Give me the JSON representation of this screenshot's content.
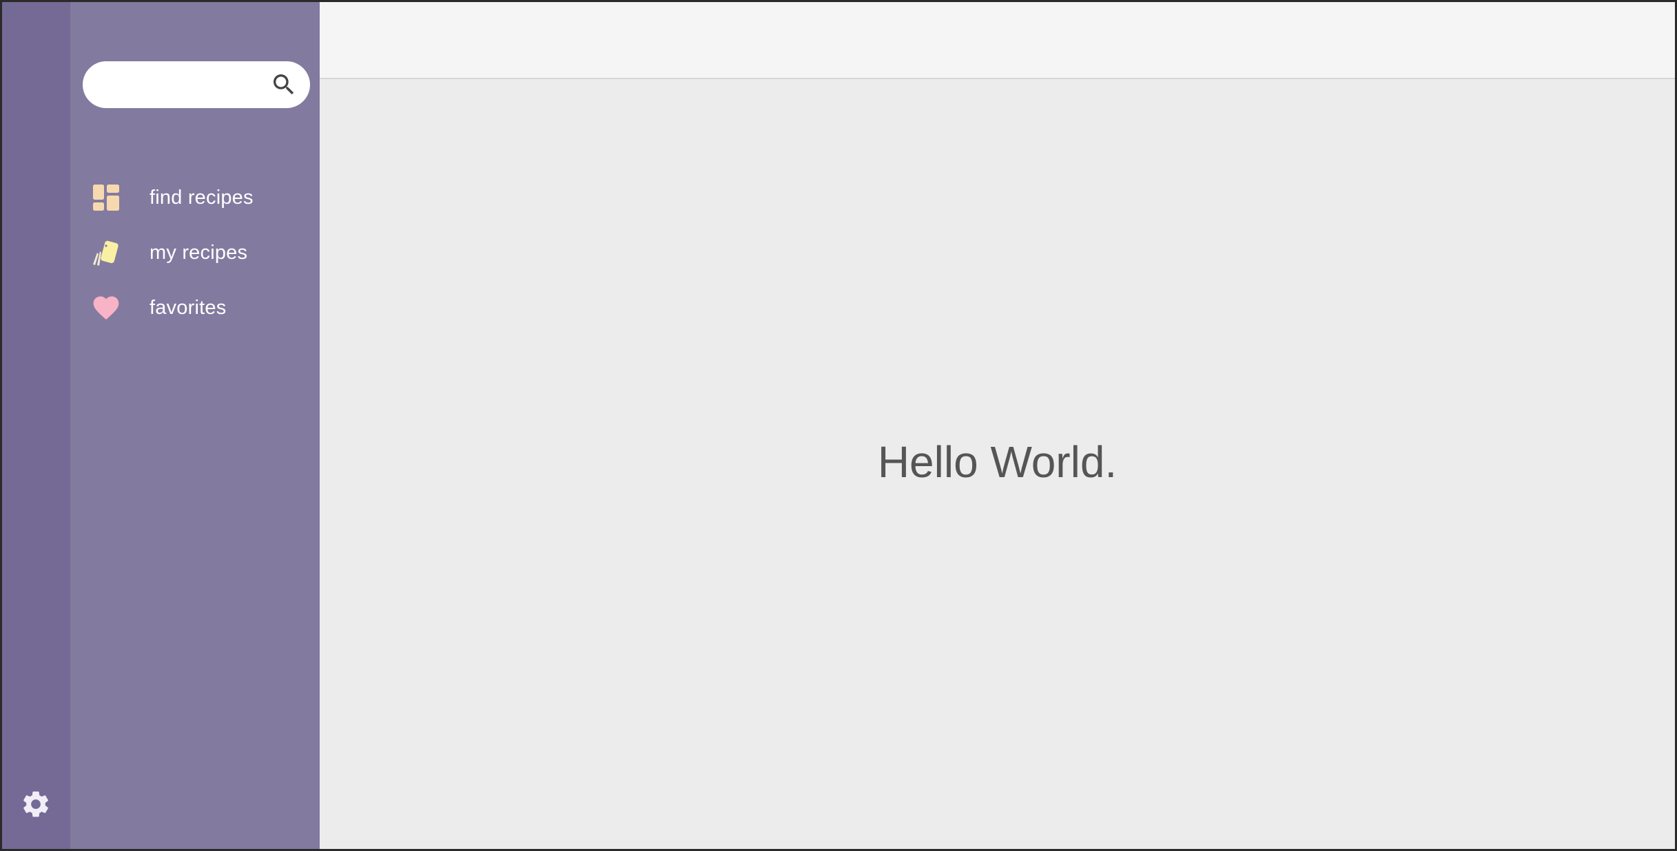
{
  "sidebar": {
    "search": {
      "value": "",
      "placeholder": "",
      "icon": "search-icon"
    },
    "items": [
      {
        "label": "find recipes",
        "icon": "dashboard-icon",
        "icon_color": "#f6d9ae"
      },
      {
        "label": "my recipes",
        "icon": "cards-icon",
        "icon_color": "#faf0a4"
      },
      {
        "label": "favorites",
        "icon": "heart-icon",
        "icon_color": "#f8b3c6"
      }
    ]
  },
  "rail": {
    "settings_icon": "gear-icon"
  },
  "main": {
    "greeting": "Hello World."
  },
  "colors": {
    "rail": "#756996",
    "sidebar": "#837a9f",
    "topbar": "#f5f5f5",
    "content": "#ececec",
    "text_main": "#555555"
  }
}
